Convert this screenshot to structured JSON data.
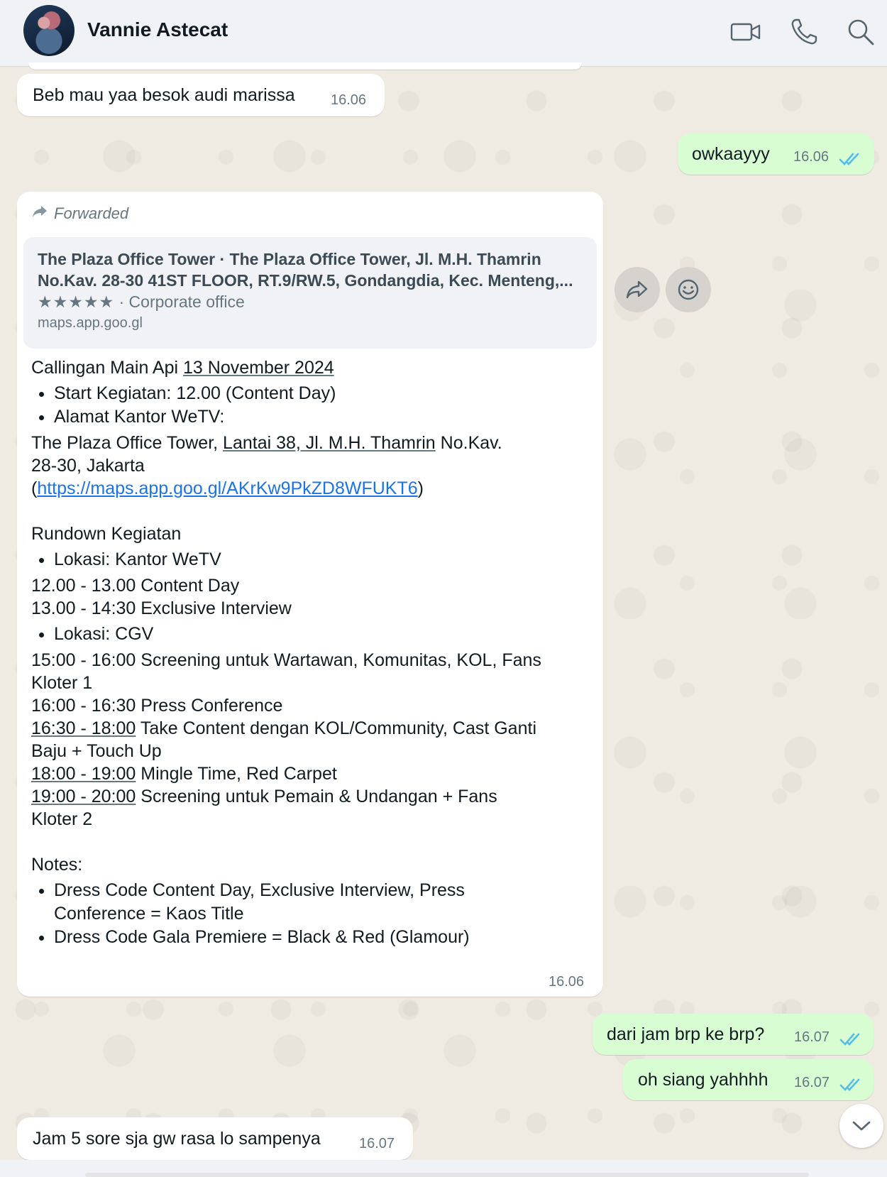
{
  "header": {
    "contact_name": "Vannie Astecat",
    "icons": [
      "video-call-icon",
      "phone-call-icon",
      "search-icon"
    ]
  },
  "messages": {
    "m1": {
      "text": "Beb mau yaa besok audi marissa",
      "time": "16.06"
    },
    "m2": {
      "text": "owkaayyy",
      "time": "16.06"
    },
    "m3": {
      "forwarded_label": "Forwarded",
      "link_title_1": "The Plaza Office Tower · The Plaza Office Tower, Jl. M.H. Thamrin",
      "link_title_2": "No.Kav. 28-30 41ST FLOOR, RT.9/RW.5, Gondangdia, Kec. Menteng,...",
      "link_stars": "★★★★★",
      "link_category": " · Corporate office",
      "link_domain": "maps.app.goo.gl",
      "line_title_a": "Callingan Main Api ",
      "line_title_b": "13 November 2024",
      "bullet_start": "Start Kegiatan: 12.00 (Content Day)",
      "bullet_alamat": "Alamat Kantor WeTV:",
      "addr_a": "The Plaza Office Tower, ",
      "addr_b": "Lantai 38, Jl. M.H. Thamrin",
      "addr_c": " No.Kav.",
      "addr_d": "28-30, Jakarta",
      "paren_open": "(",
      "maps_link": "https://maps.app.goo.gl/AKrKw9PkZD8WFUKT6",
      "paren_close": ")",
      "rundown_title": "Rundown Kegiatan",
      "lokasi_wetv": "Lokasi: Kantor WeTV",
      "r1": "12.00 - 13.00 Content Day",
      "r2": "13.00 - 14:30 Exclusive Interview",
      "lokasi_cgv": "Lokasi: CGV",
      "r3": "15:00 - 16:00 Screening untuk Wartawan, Komunitas, KOL, Fans",
      "r3b": "Kloter 1",
      "r4": "16:00 - 16:30 Press Conference",
      "r5_time": "16:30 - 18:00",
      "r5_text": " Take Content dengan KOL/Community, Cast Ganti",
      "r5b": "Baju + Touch Up",
      "r6_time": "18:00 - 19:00",
      "r6_text": " Mingle Time, Red Carpet",
      "r7_time": "19:00 - 20:00",
      "r7_text": " Screening untuk Pemain & Undangan + Fans",
      "r7b": "Kloter 2",
      "notes_title": "Notes:",
      "note1a": "Dress Code Content Day, Exclusive Interview, Press",
      "note1b": "Conference = Kaos Title",
      "note2": "Dress Code Gala Premiere = Black & Red (Glamour)",
      "time": "16.06"
    },
    "m4": {
      "text": "dari jam brp ke brp?",
      "time": "16.07"
    },
    "m5": {
      "text": "oh siang yahhhh",
      "time": "16.07"
    },
    "m6": {
      "text": "Jam 5 sore sja gw rasa lo sampenya",
      "time": "16.07"
    }
  },
  "colors": {
    "incoming_bubble": "#ffffff",
    "outgoing_bubble": "#d9fdd3",
    "read_ticks": "#53bdeb",
    "link": "#1a73e8"
  }
}
